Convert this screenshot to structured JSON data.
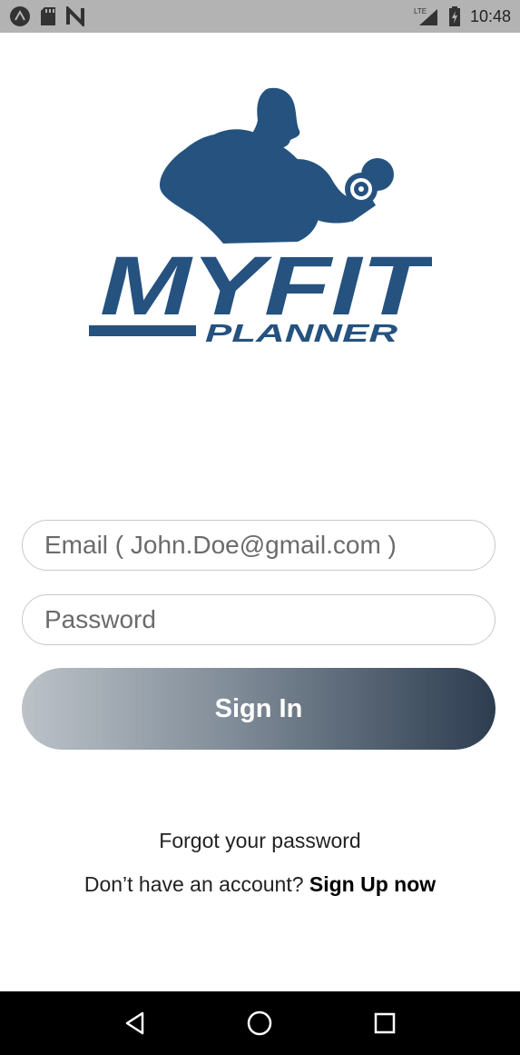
{
  "status_bar": {
    "time": "10:48",
    "network_label": "LTE",
    "icons": [
      "android-icon",
      "sd-card-icon",
      "nfc-icon",
      "signal-icon",
      "battery-charging-icon"
    ]
  },
  "logo": {
    "title": "MYFIT",
    "subtitle": "PLANNER",
    "brand_color": "#25527f"
  },
  "form": {
    "email_placeholder": "Email ( John.Doe@gmail.com )",
    "password_placeholder": "Password",
    "signin_label": "Sign In"
  },
  "links": {
    "forgot_password": "Forgot your password",
    "no_account_prefix": "Don’t have an account?",
    "signup_label": "Sign Up now"
  },
  "nav_bar": {
    "icons": [
      "back-icon",
      "home-icon",
      "recents-icon"
    ]
  },
  "colors": {
    "status_bar": "#b3b3b3",
    "button_gradient_start": "#bcc2c8",
    "button_gradient_end": "#2d3d50",
    "nav_bar": "#000000"
  }
}
